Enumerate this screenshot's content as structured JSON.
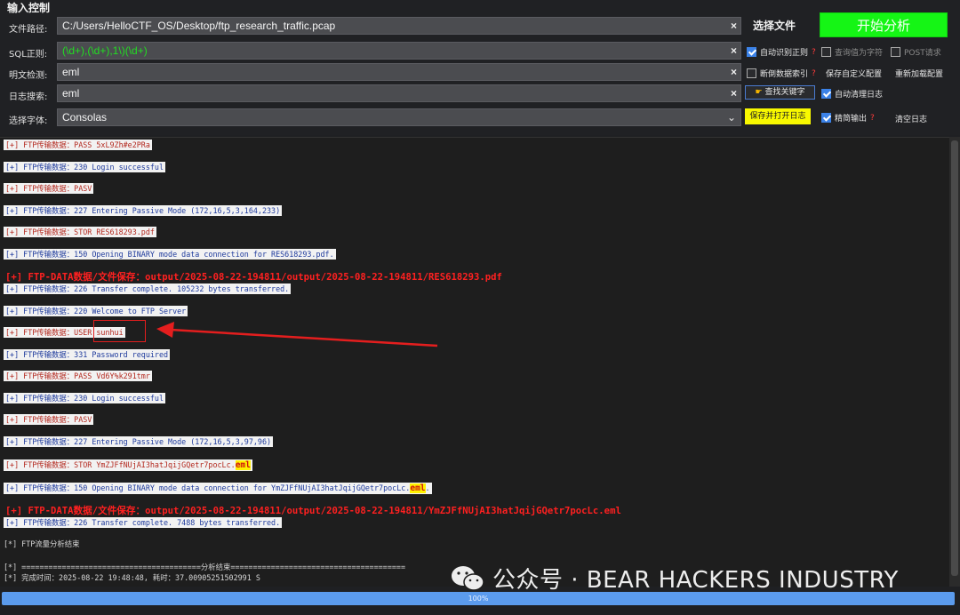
{
  "panel": {
    "title": "输入控制",
    "path_label": "文件路径:",
    "path_value": "C:/Users/HelloCTF_OS/Desktop/ftp_research_traffic.pcap",
    "sql_label": "SQL正则:",
    "sql_value": "(\\d+),(\\d+),1\\)(\\d+)",
    "plain_label": "明文检测:",
    "plain_value": "eml",
    "log_label": "日志搜索:",
    "log_value": "eml",
    "font_label": "选择字体:",
    "font_value": "Consolas",
    "clear_glyph": "×",
    "chevron_glyph": "⌄"
  },
  "buttons": {
    "choose_file": "选择文件",
    "start": "开始分析",
    "save_custom": "保存自定义配置",
    "reload": "重新加载配置",
    "find_keyword": "查找关键字",
    "save_open_log": "保存并打开日志",
    "clear_log": "清空日志"
  },
  "checks": {
    "auto_regex": "自动识别正则",
    "query_char": "查询值为字符",
    "post": "POST请求",
    "break_index": "断倒数据索引",
    "auto_clear": "自动清理日志",
    "concise": "精简输出",
    "q_mark": "?"
  },
  "log": {
    "lines": [
      "[+] FTP传输数据：PASS 5xL9Zh#e2PRa",
      "[+] FTP传输数据：230 Login successful",
      "[+] FTP传输数据：PASV",
      "[+] FTP传输数据：227 Entering Passive Mode (172,16,5,3,164,233)",
      "[+] FTP传输数据：STOR RES618293.pdf",
      "[+] FTP传输数据：150 Opening BINARY mode data connection for RES618293.pdf.",
      "[+] FTP-DATA数据/文件保存：output/2025-08-22-194811/output/2025-08-22-194811/RES618293.pdf",
      "[+] FTP传输数据：226 Transfer complete. 105232 bytes transferred.",
      "[+] FTP传输数据：220 Welcome to FTP Server",
      "[+] FTP传输数据：USER sunhui",
      "[+] FTP传输数据：331 Password required",
      "[+] FTP传输数据：PASS Vd6Y%k291tmr",
      "[+] FTP传输数据：230 Login successful",
      "[+] FTP传输数据：PASV",
      "[+] FTP传输数据：227 Entering Passive Mode (172,16,5,3,97,96)",
      "[+] FTP传输数据：STOR YmZJFfNUjAI3hatJqijGQetr7pocLc.",
      "eml",
      "[+] FTP传输数据：150 Opening BINARY mode data connection for YmZJFfNUjAI3hatJqijGQetr7pocLc.",
      "eml",
      ".",
      "[+] FTP-DATA数据/文件保存：output/2025-08-22-194811/output/2025-08-22-194811/YmZJFfNUjAI3hatJqijGQetr7pocLc.eml",
      "[+] FTP传输数据：226 Transfer complete. 7488 bytes transferred.",
      "[*] FTP流量分析结束",
      "[*] ========================================分析结束=======================================",
      "[*] 完成时间：2025-08-22 19:48:48, 耗时：37.00905251502991 S"
    ]
  },
  "watermark": "公众号 · BEAR HACKERS INDUSTRY",
  "progress": "100%",
  "colors": {
    "accent_green": "#15f515",
    "progress_blue": "#5b9bed",
    "highlight_yellow": "#fff200",
    "annotation_red": "#e41e1e"
  }
}
